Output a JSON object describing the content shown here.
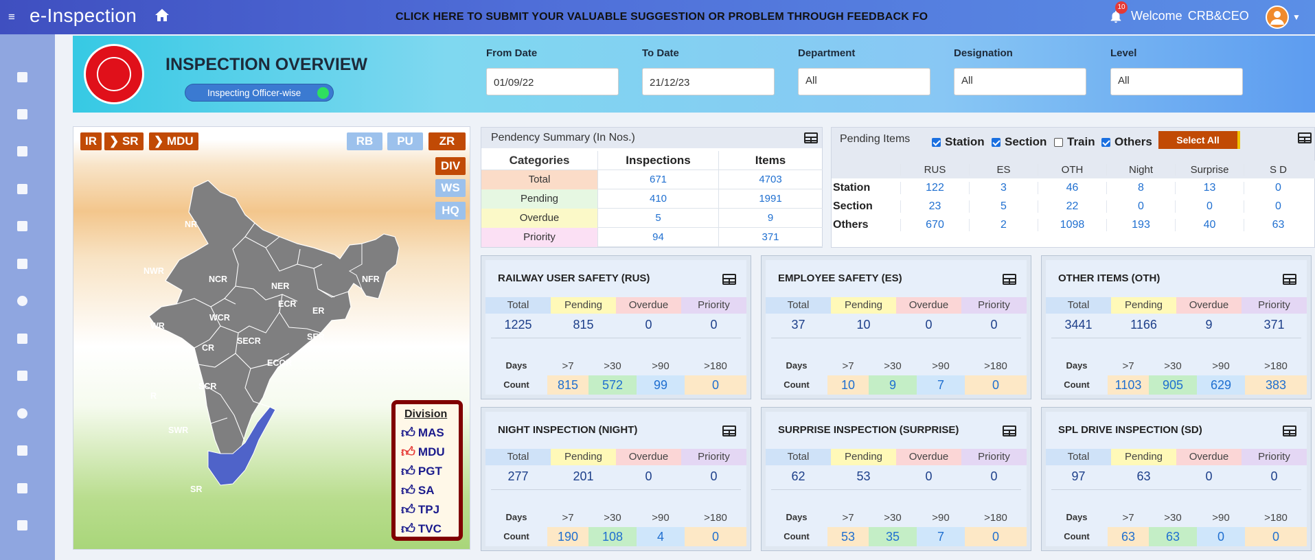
{
  "topbar": {
    "menu_icon": "hamburger-icon",
    "app_title": "e-Inspection",
    "feedback": "CLICK HERE TO SUBMIT YOUR VALUABLE SUGGESTION OR PROBLEM THROUGH FEEDBACK FO",
    "notification_count": "10",
    "welcome": "Welcome",
    "user": "CRB&CEO"
  },
  "header": {
    "title": "INSPECTION OVERVIEW",
    "toggle_label": "Inspecting Officer-wise",
    "from_date_label": "From Date",
    "from_date": "01/09/22",
    "to_date_label": "To Date",
    "to_date": "21/12/23",
    "department_label": "Department",
    "department": "All",
    "designation_label": "Designation",
    "designation": "All",
    "level_label": "Level",
    "level": "All"
  },
  "map": {
    "breadcrumb": [
      "IR",
      "SR",
      "MDU"
    ],
    "levels_top": [
      "RB",
      "PU",
      "ZR"
    ],
    "levels_side": [
      "DIV",
      "WS",
      "HQ"
    ],
    "regions": [
      "NR",
      "NFR",
      "NWR",
      "NCR",
      "NER",
      "ECR",
      "ER",
      "WR",
      "WCR",
      "CR",
      "SECR",
      "SER",
      "ECOR",
      "R",
      "SCR",
      "SWR",
      "SR"
    ],
    "division_title": "Division",
    "divisions": [
      "MAS",
      "MDU",
      "PGT",
      "SA",
      "TPJ",
      "TVC"
    ],
    "active_division": "MDU"
  },
  "pendency": {
    "title": "Pendency Summary (In Nos.)",
    "headers": [
      "Categories",
      "Inspections",
      "Items"
    ],
    "rows": [
      {
        "cat": "Total",
        "insp": "671",
        "items": "4703",
        "color": "#fbdcc8"
      },
      {
        "cat": "Pending",
        "insp": "410",
        "items": "1991",
        "color": "#e6f7e2"
      },
      {
        "cat": "Overdue",
        "insp": "5",
        "items": "9",
        "color": "#fbf9c8"
      },
      {
        "cat": "Priority",
        "insp": "94",
        "items": "371",
        "color": "#fbe0f4"
      }
    ]
  },
  "pending_items": {
    "title": "Pending Items",
    "filters": [
      {
        "label": "Station",
        "checked": true
      },
      {
        "label": "Section",
        "checked": true
      },
      {
        "label": "Train",
        "checked": false
      },
      {
        "label": "Others",
        "checked": true
      }
    ],
    "select_all": "Select All",
    "columns": [
      "RUS",
      "ES",
      "OTH",
      "Night",
      "Surprise",
      "S D"
    ],
    "rows": [
      {
        "label": "Station",
        "values": [
          "122",
          "3",
          "46",
          "8",
          "13",
          "0"
        ]
      },
      {
        "label": "Section",
        "values": [
          "23",
          "5",
          "22",
          "0",
          "0",
          "0"
        ]
      },
      {
        "label": "Others",
        "values": [
          "670",
          "2",
          "1098",
          "193",
          "40",
          "63"
        ]
      }
    ]
  },
  "card_labels": {
    "total": "Total",
    "pending": "Pending",
    "overdue": "Overdue",
    "priority": "Priority",
    "days": "Days",
    "count": "Count",
    "d7": ">7",
    "d30": ">30",
    "d90": ">90",
    "d180": ">180"
  },
  "cards": [
    {
      "title": "RAILWAY USER SAFETY (RUS)",
      "total": "1225",
      "pending": "815",
      "overdue": "0",
      "priority": "0",
      "c7": "815",
      "c30": "572",
      "c90": "99",
      "c180": "0"
    },
    {
      "title": "EMPLOYEE SAFETY (ES)",
      "total": "37",
      "pending": "10",
      "overdue": "0",
      "priority": "0",
      "c7": "10",
      "c30": "9",
      "c90": "7",
      "c180": "0"
    },
    {
      "title": "OTHER ITEMS (OTH)",
      "total": "3441",
      "pending": "1166",
      "overdue": "9",
      "priority": "371",
      "c7": "1103",
      "c30": "905",
      "c90": "629",
      "c180": "383"
    },
    {
      "title": "NIGHT INSPECTION (NIGHT)",
      "total": "277",
      "pending": "201",
      "overdue": "0",
      "priority": "0",
      "c7": "190",
      "c30": "108",
      "c90": "4",
      "c180": "0"
    },
    {
      "title": "SURPRISE INSPECTION (SURPRISE)",
      "total": "62",
      "pending": "53",
      "overdue": "0",
      "priority": "0",
      "c7": "53",
      "c30": "35",
      "c90": "7",
      "c180": "0"
    },
    {
      "title": "SPL DRIVE INSPECTION (SD)",
      "total": "97",
      "pending": "63",
      "overdue": "0",
      "priority": "0",
      "c7": "63",
      "c30": "63",
      "c90": "0",
      "c180": "0"
    }
  ]
}
